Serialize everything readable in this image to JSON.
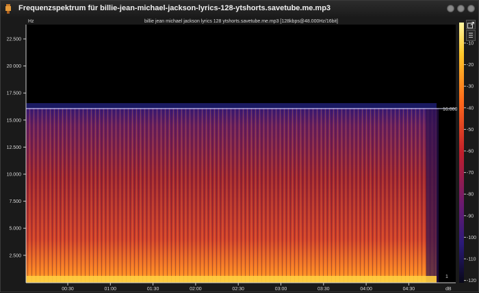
{
  "window": {
    "title": "Frequenzspektrum für billie-jean-michael-jackson-lyrics-128-ytshorts.savetube.me.mp3",
    "buttons": [
      "minimize-button",
      "maximize-button",
      "close-button"
    ]
  },
  "plot": {
    "file_info": "billie jean michael jackson lyrics 128 ytshorts.savetube.me.mp3 [128kbps@48.000Hz/16bit]",
    "y_unit": "Hz",
    "y_ticks": [
      "22.500",
      "20 000",
      "17.500",
      "15.000",
      "12.500",
      "10.000",
      "7.500",
      "5.000",
      "2.500"
    ],
    "x_ticks": [
      "00:30",
      "01:00",
      "01:30",
      "02:00",
      "02:30",
      "03:00",
      "03:30",
      "04:00",
      "04:30"
    ],
    "cutoff_label": "16.000",
    "cutoff_hz": 16000,
    "colorbar_ticks": [
      "-10",
      "-20",
      "-30",
      "-40",
      "-50",
      "-60",
      "-70",
      "-80",
      "-90",
      "-100",
      "-110",
      "-120"
    ],
    "colorbar_unit": "dB",
    "right_edge_label": "1",
    "colors": {
      "background": "#000000",
      "low": "#4a1a78",
      "mid": "#c0302a",
      "high": "#ffd23a",
      "cutoff_line": "#e8e8ff"
    }
  }
}
